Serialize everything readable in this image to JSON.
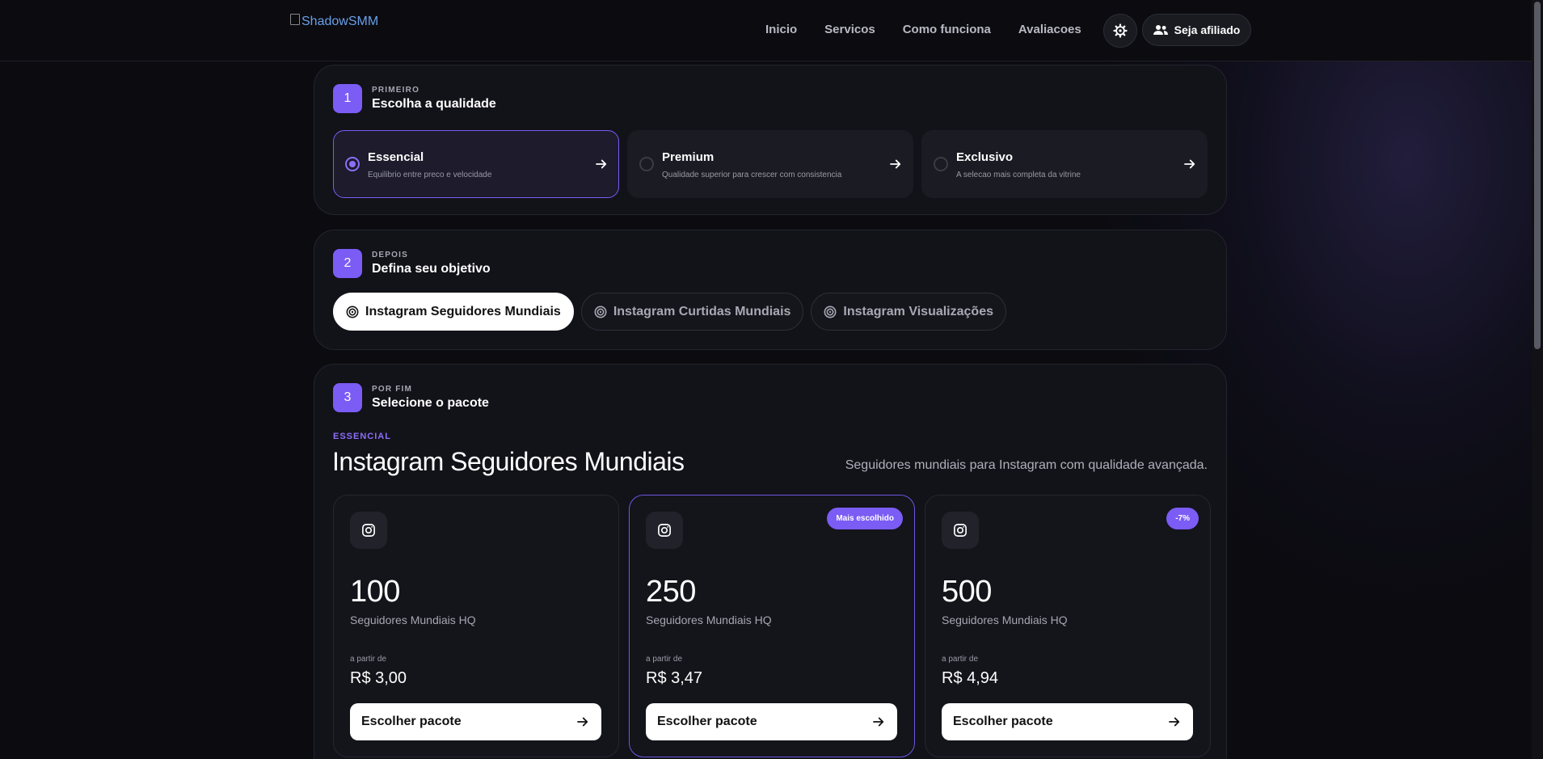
{
  "header": {
    "logo_text": "ShadowSMM",
    "nav": [
      "Inicio",
      "Servicos",
      "Como funciona",
      "Avaliacoes"
    ],
    "theme_icon": "gear-icon",
    "affiliate_label": "Seja afiliado",
    "affiliate_icon": "users-icon"
  },
  "step1": {
    "number": "1",
    "kicker": "PRIMEIRO",
    "title": "Escolha a qualidade",
    "options": [
      {
        "name": "Essencial",
        "desc": "Equilibrio entre preco e velocidade",
        "selected": true
      },
      {
        "name": "Premium",
        "desc": "Qualidade superior para crescer com consistencia",
        "selected": false
      },
      {
        "name": "Exclusivo",
        "desc": "A selecao mais completa da vitrine",
        "selected": false
      }
    ]
  },
  "step2": {
    "number": "2",
    "kicker": "DEPOIS",
    "title": "Defina seu objetivo",
    "options": [
      {
        "label": "Instagram Seguidores Mundiais",
        "selected": true
      },
      {
        "label": "Instagram Curtidas Mundiais",
        "selected": false
      },
      {
        "label": "Instagram Visualizações",
        "selected": false
      }
    ]
  },
  "step3": {
    "number": "3",
    "kicker": "POR FIM",
    "title": "Selecione o pacote",
    "tag": "ESSENCIAL",
    "heading": "Instagram Seguidores Mundiais",
    "description": "Seguidores mundiais para Instagram com qualidade avançada.",
    "packages": [
      {
        "qty": "100",
        "label": "Seguidores Mundiais HQ",
        "from": "a partir de",
        "price": "R$ 3,00",
        "badge": "",
        "button": "Escolher pacote"
      },
      {
        "qty": "250",
        "label": "Seguidores Mundiais HQ",
        "from": "a partir de",
        "price": "R$ 3,47",
        "badge": "Mais escolhido",
        "button": "Escolher pacote"
      },
      {
        "qty": "500",
        "label": "Seguidores Mundiais HQ",
        "from": "a partir de",
        "price": "R$ 4,94",
        "badge": "-7%",
        "button": "Escolher pacote"
      }
    ]
  },
  "colors": {
    "accent": "#7b5cf5",
    "background": "#0b0b10",
    "card": "#121219"
  }
}
